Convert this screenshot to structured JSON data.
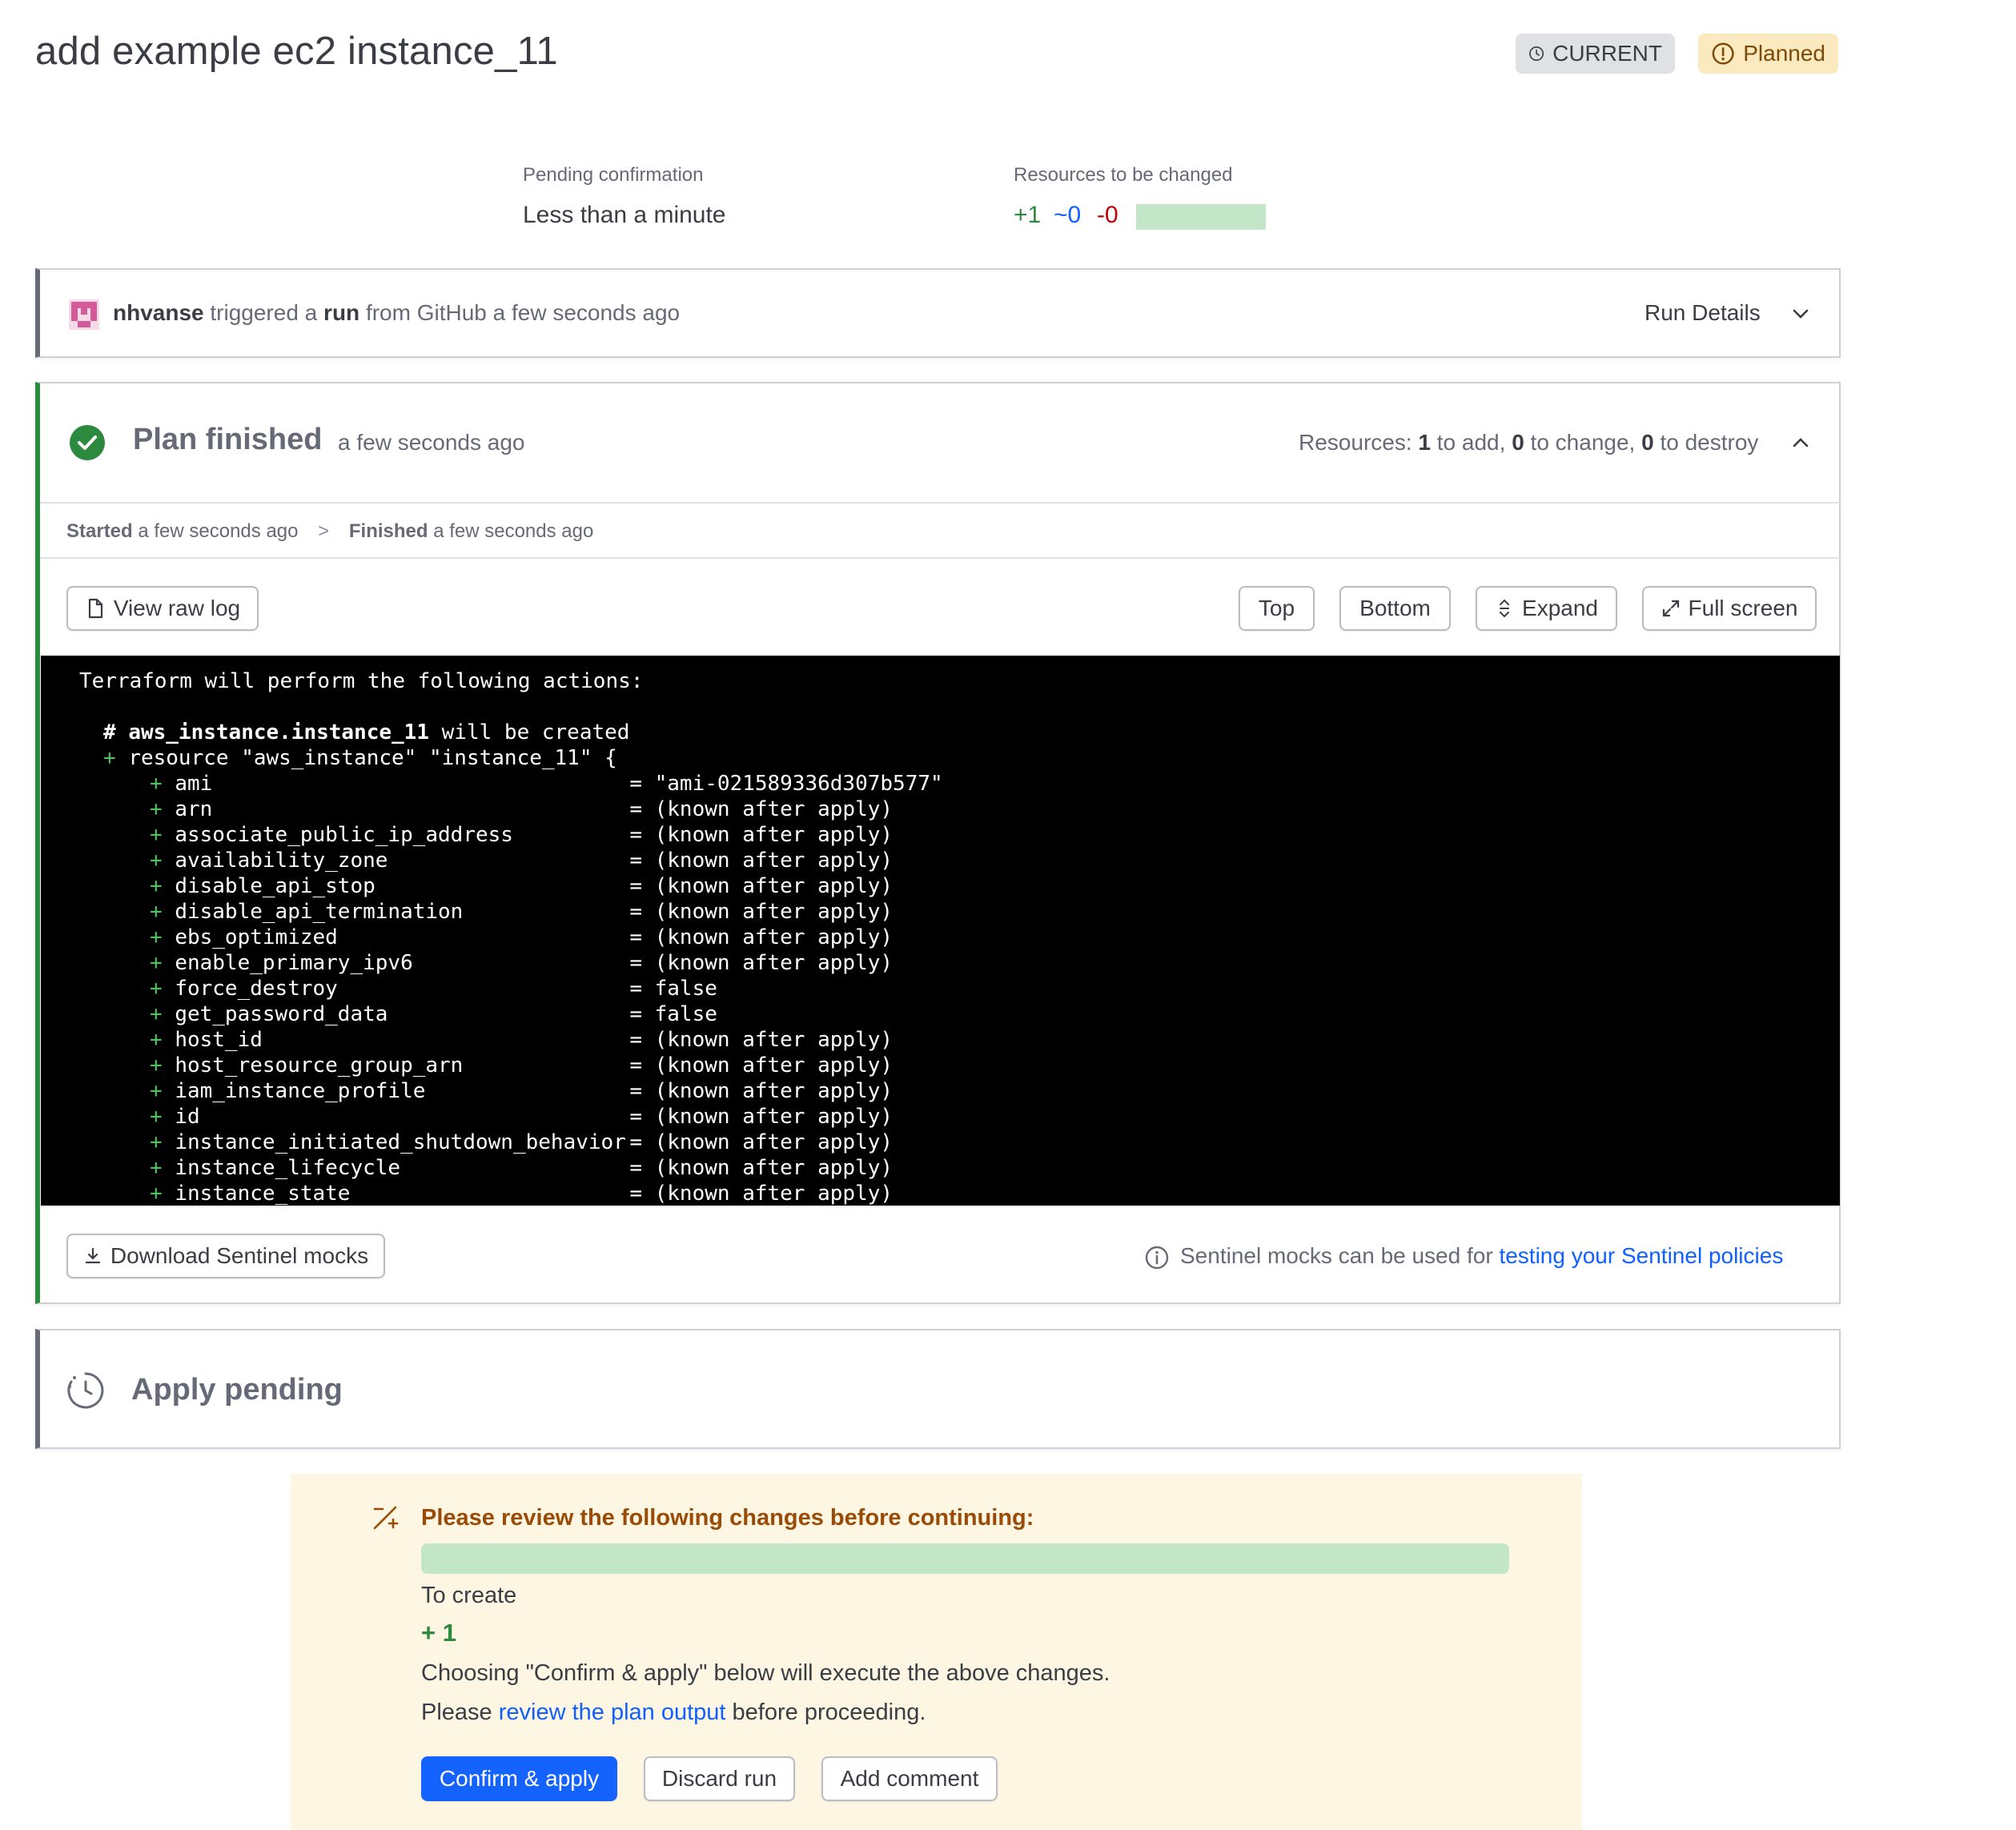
{
  "header": {
    "title": "add example ec2 instance_11",
    "badges": [
      {
        "label": "CURRENT",
        "icon": "clock-icon"
      },
      {
        "label": "Planned",
        "icon": "alert-circle-icon"
      }
    ]
  },
  "stats": {
    "pending": {
      "label": "Pending confirmation",
      "value": "Less than a minute"
    },
    "resources": {
      "label": "Resources to be changed",
      "add": "+1",
      "change": "~0",
      "destroy": "-0",
      "add_fraction": 1.0
    }
  },
  "run_card": {
    "user": "nhvanse",
    "text_triggered": "triggered a",
    "text_run": "run",
    "text_from": "from GitHub a few seconds ago",
    "details_label": "Run Details"
  },
  "plan_card": {
    "title": "Plan finished",
    "time": "a few seconds ago",
    "resources_prefix": "Resources:",
    "add_count": "1",
    "add_text": "to add,",
    "change_count": "0",
    "change_text": "to change,",
    "destroy_count": "0",
    "destroy_text": "to destroy",
    "started_label": "Started",
    "started_time": "a few seconds ago",
    "separator": ">",
    "finished_label": "Finished",
    "finished_time": "a few seconds ago",
    "buttons": {
      "view_raw_log": "View raw log",
      "top": "Top",
      "bottom": "Bottom",
      "expand": "Expand",
      "full_screen": "Full screen",
      "download_mocks": "Download Sentinel mocks"
    },
    "sentinel_note_prefix": "Sentinel mocks can be used for",
    "sentinel_note_link": "testing your Sentinel policies"
  },
  "terminal": {
    "header": "Terraform will perform the following actions:",
    "comment_prefix": "# ",
    "comment_resource": "aws_instance.instance_11",
    "comment_suffix": " will be created",
    "resource_line": "resource \"aws_instance\" \"instance_11\" {",
    "attributes": [
      {
        "name": "ami",
        "value": "\"ami-021589336d307b577\""
      },
      {
        "name": "arn",
        "value": "(known after apply)"
      },
      {
        "name": "associate_public_ip_address",
        "value": "(known after apply)"
      },
      {
        "name": "availability_zone",
        "value": "(known after apply)"
      },
      {
        "name": "disable_api_stop",
        "value": "(known after apply)"
      },
      {
        "name": "disable_api_termination",
        "value": "(known after apply)"
      },
      {
        "name": "ebs_optimized",
        "value": "(known after apply)"
      },
      {
        "name": "enable_primary_ipv6",
        "value": "(known after apply)"
      },
      {
        "name": "force_destroy",
        "value": "false"
      },
      {
        "name": "get_password_data",
        "value": "false"
      },
      {
        "name": "host_id",
        "value": "(known after apply)"
      },
      {
        "name": "host_resource_group_arn",
        "value": "(known after apply)"
      },
      {
        "name": "iam_instance_profile",
        "value": "(known after apply)"
      },
      {
        "name": "id",
        "value": "(known after apply)"
      },
      {
        "name": "instance_initiated_shutdown_behavior",
        "value": "(known after apply)"
      },
      {
        "name": "instance_lifecycle",
        "value": "(known after apply)"
      },
      {
        "name": "instance_state",
        "value": "(known after apply)"
      }
    ]
  },
  "apply_card": {
    "title": "Apply pending"
  },
  "review": {
    "heading": "Please review the following changes before continuing:",
    "to_create_label": "To create",
    "to_create_count": "+ 1",
    "note": "Choosing \"Confirm & apply\" below will execute the above changes.",
    "please_prefix": "Please",
    "please_link": "review the plan output",
    "please_suffix": "before proceeding.",
    "buttons": {
      "confirm": "Confirm & apply",
      "discard": "Discard run",
      "comment": "Add comment"
    }
  },
  "colors": {
    "green": "#2c8a3f",
    "blue": "#1060ff",
    "red": "#c00005",
    "bar_green": "#c3e6c8",
    "review_bg": "#fdf6e3",
    "review_heading": "#9a4b06"
  }
}
